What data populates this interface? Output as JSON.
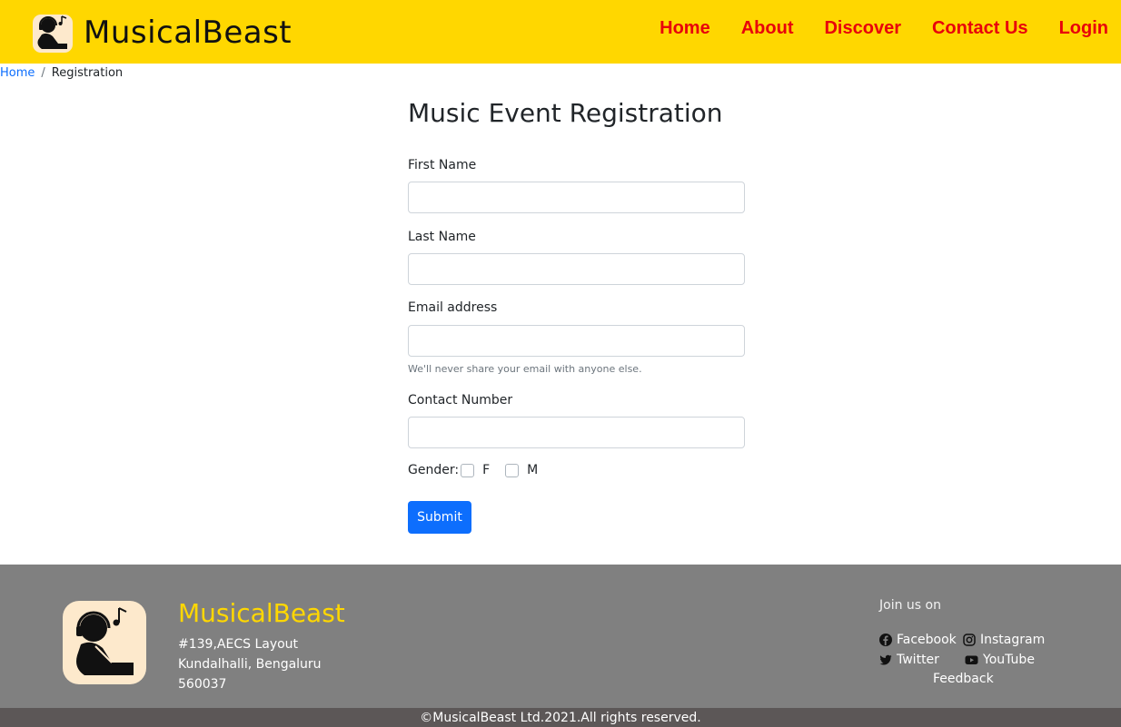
{
  "brand": {
    "name": "MusicalBeast",
    "logo_icon": "listener-icon"
  },
  "nav": {
    "items": [
      {
        "label": "Home"
      },
      {
        "label": "About"
      },
      {
        "label": "Discover"
      },
      {
        "label": "Contact Us"
      },
      {
        "label": "Login"
      }
    ]
  },
  "breadcrumb": {
    "home": "Home",
    "separator": "/",
    "current": "Registration"
  },
  "form": {
    "title": "Music Event Registration",
    "first_name_label": "First Name",
    "first_name_value": "",
    "last_name_label": "Last Name",
    "last_name_value": "",
    "email_label": "Email address",
    "email_value": "",
    "email_help": "We'll never share your email with anyone else.",
    "contact_label": "Contact Number",
    "contact_value": "",
    "gender_label": "Gender:",
    "gender_options": [
      "F",
      "M"
    ],
    "submit_label": "Submit"
  },
  "footer": {
    "brand": "MusicalBeast",
    "address_lines": [
      "#139,AECS Layout",
      "Kundalhalli, Bengaluru",
      "560037"
    ],
    "join_label": "Join us on",
    "social": [
      {
        "label": "Facebook",
        "icon": "facebook-icon"
      },
      {
        "label": "Instagram",
        "icon": "instagram-icon"
      },
      {
        "label": "Twitter",
        "icon": "twitter-icon"
      },
      {
        "label": "YouTube",
        "icon": "youtube-icon"
      }
    ],
    "feedback": "Feedback",
    "copyright": "©MusicalBeast Ltd.2021.All rights reserved."
  },
  "colors": {
    "navbar_bg": "#ffd700",
    "nav_link": "#e8000b",
    "primary": "#0d6efd",
    "footer_bg": "#808080",
    "footer_brand": "#ffd700",
    "copyright_bg": "#5c5757"
  }
}
